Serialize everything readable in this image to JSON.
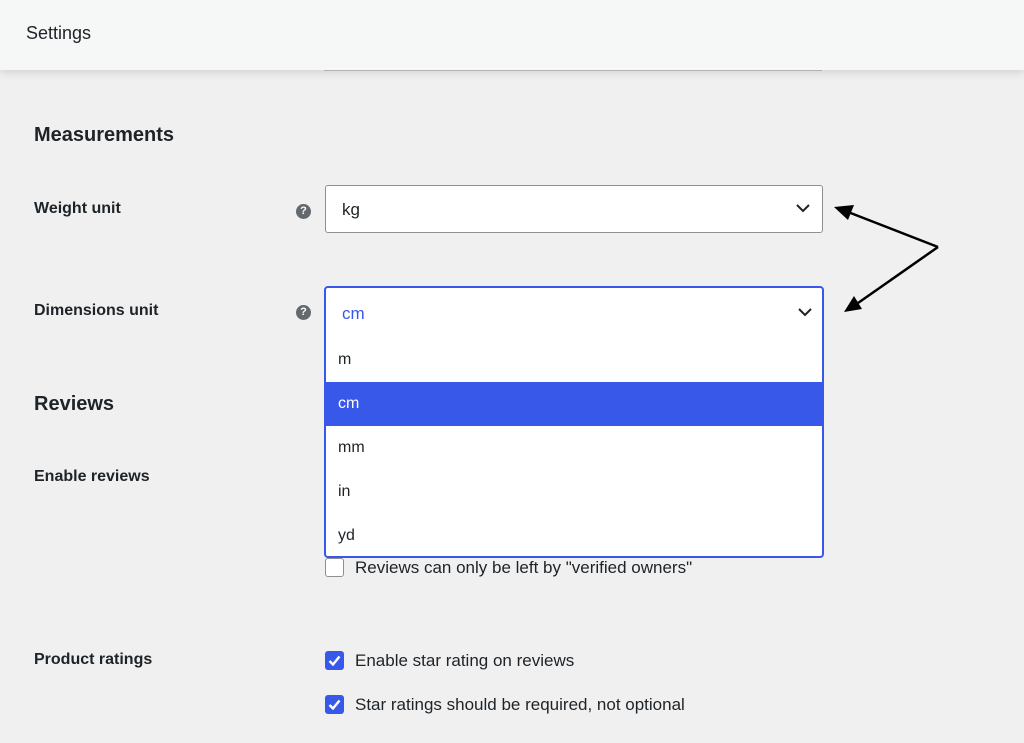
{
  "header": {
    "title": "Settings"
  },
  "measurements": {
    "heading": "Measurements",
    "weight_unit": {
      "label": "Weight unit",
      "help": "?",
      "value": "kg"
    },
    "dimensions_unit": {
      "label": "Dimensions unit",
      "help": "?",
      "value": "cm",
      "options": [
        "m",
        "cm",
        "mm",
        "in",
        "yd"
      ],
      "highlighted": "cm"
    }
  },
  "reviews": {
    "heading": "Reviews",
    "enable_reviews_label": "Enable reviews",
    "verified_owners": {
      "label": "Reviews can only be left by \"verified owners\"",
      "checked": false
    }
  },
  "ratings": {
    "label": "Product ratings",
    "enable_star_rating": {
      "label": "Enable star rating on reviews",
      "checked": true
    },
    "star_required": {
      "label": "Star ratings should be required, not optional",
      "checked": true
    }
  },
  "colors": {
    "accent": "#3858e9",
    "background": "#f0f0f1",
    "text": "#1d2327",
    "annotation": "#000000"
  },
  "icons": [
    "help-icon",
    "chevron-down-icon",
    "checkmark-icon",
    "annotation-arrow-icon"
  ]
}
